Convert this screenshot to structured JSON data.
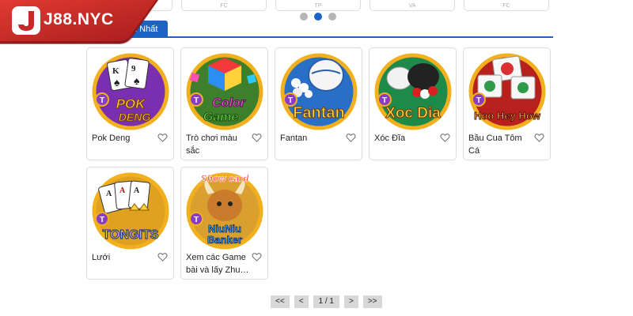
{
  "brand": {
    "logo_text": "J88.NYC"
  },
  "top_cards": [
    {
      "label": ""
    },
    {
      "label": "FC"
    },
    {
      "label": "TP"
    },
    {
      "label": "VA"
    },
    {
      "label": "FC"
    }
  ],
  "carousel": {
    "total_dots": 3,
    "active_index": 1
  },
  "tabs": {
    "active_label": "Hot Nhất"
  },
  "games": [
    {
      "name": "Pok Deng",
      "icon": "pok-deng-thumbnail",
      "art_text": "POK DENG"
    },
    {
      "name": "Trò chơi màu sắc",
      "icon": "color-game-thumbnail",
      "art_text": "Color Game"
    },
    {
      "name": "Fantan",
      "icon": "fantan-thumbnail",
      "art_text": "Fantan"
    },
    {
      "name": "Xóc Đĩa",
      "icon": "xoc-dia-thumbnail",
      "art_text": "Xoc Dia"
    },
    {
      "name": "Bầu Cua Tôm Cá",
      "icon": "hoo-hey-how-thumbnail",
      "art_text": "Hoo Hey How"
    },
    {
      "name": "Lưới",
      "icon": "tongits-thumbnail",
      "art_text": "TONGITS"
    },
    {
      "name": "Xem các Game bài và lấy Zhu…",
      "icon": "niu-niu-banker-thumbnail",
      "art_text": "Show card",
      "art_text_2": "NiuNiu Banker"
    }
  ],
  "brand_badge": "T",
  "pagination": {
    "first_label": "<<",
    "prev_label": "<",
    "page_info": "1 / 1",
    "next_label": ">",
    "last_label": ">>"
  },
  "colors": {
    "accent": "#1d63c7",
    "logo_red": "#c42a2a",
    "ring_gold": "#f2b01e"
  }
}
